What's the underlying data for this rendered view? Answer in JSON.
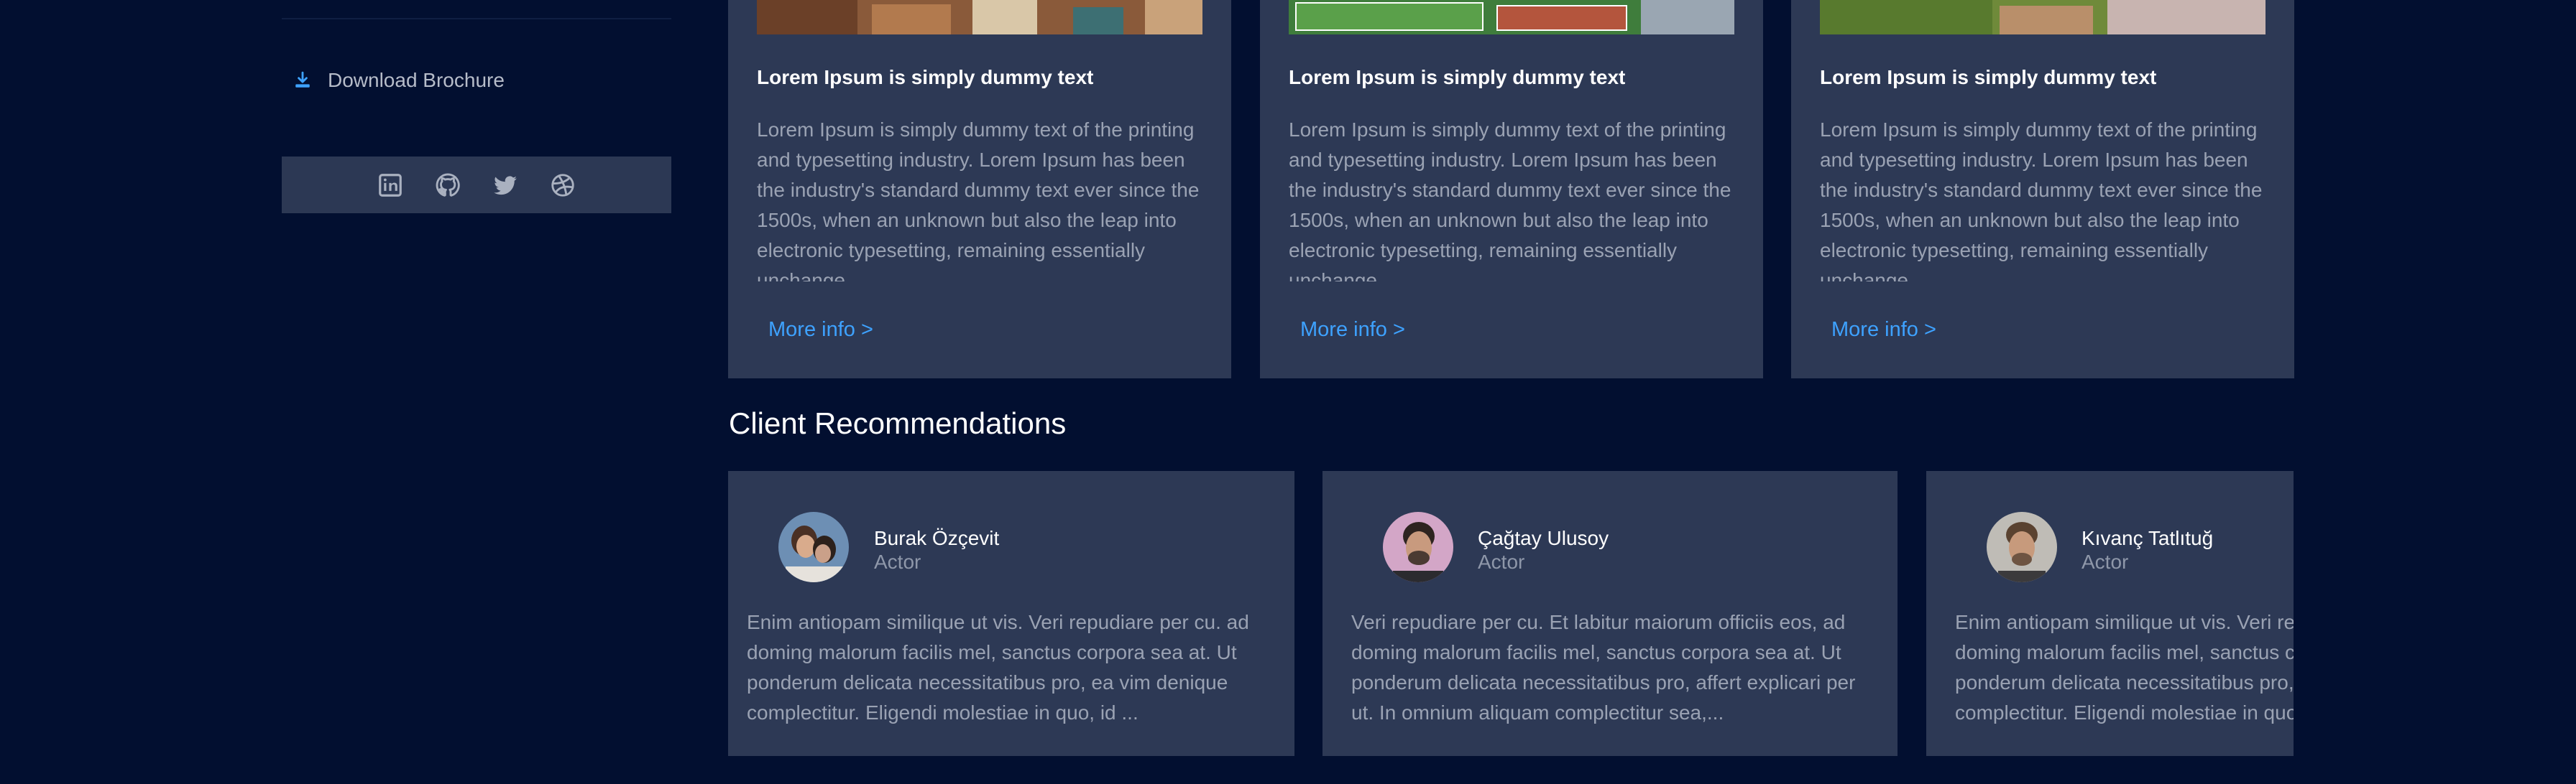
{
  "sidebar": {
    "download_label": "Download Brochure",
    "social_icons": [
      "linkedin-icon",
      "github-icon",
      "twitter-icon",
      "dribbble-icon"
    ]
  },
  "cards": [
    {
      "title": "Lorem Ipsum is simply dummy text",
      "body": "Lorem Ipsum is simply dummy text of the printing and typesetting industry. Lorem Ipsum has been the industry's standard dummy text ever since the 1500s, when an unknown but also the leap into electronic typesetting, remaining essentially unchange",
      "link": "More info >"
    },
    {
      "title": "Lorem Ipsum is simply dummy text",
      "body": "Lorem Ipsum is simply dummy text of the printing and typesetting industry. Lorem Ipsum has been the industry's standard dummy text ever since the 1500s, when an unknown but also the leap into electronic typesetting, remaining essentially unchange",
      "link": "More info >"
    },
    {
      "title": "Lorem Ipsum is simply dummy text",
      "body": "Lorem Ipsum is simply dummy text of the printing and typesetting industry. Lorem Ipsum has been the industry's standard dummy text ever since the 1500s, when an unknown but also the leap into electronic typesetting, remaining essentially unchange",
      "link": "More info >"
    }
  ],
  "recommendations": {
    "title": "Client Recommendations",
    "items": [
      {
        "name": "Burak Özçevit",
        "role": "Actor",
        "text": "Enim antiopam similique ut vis. Veri repudiare per cu. ad doming malorum facilis mel, sanctus corpora sea at. Ut ponderum delicata necessitatibus pro, ea vim denique complectitur. Eligendi molestiae in quo, id ..."
      },
      {
        "name": "Çağtay Ulusoy",
        "role": "Actor",
        "text": "Veri repudiare per cu. Et labitur maiorum officiis eos, ad doming malorum facilis mel, sanctus corpora sea at. Ut ponderum delicata necessitatibus pro, affert explicari per ut. In omnium aliquam complectitur sea,..."
      },
      {
        "name": "Kıvanç Tatlıtuğ",
        "role": "Actor",
        "text": "Enim antiopam similique ut vis. Veri repudiare per cu. ad doming malorum facilis mel, sanctus corpora sea at. Ut ponderum delicata necessitatibus pro, ea vim denique complectitur. Eligendi molestiae in quo, id ..."
      }
    ]
  },
  "colors": {
    "page_bg": "#020f30",
    "card_bg": "#2d3955",
    "link": "#3ea2ff",
    "download_icon": "#3ea2ff"
  }
}
